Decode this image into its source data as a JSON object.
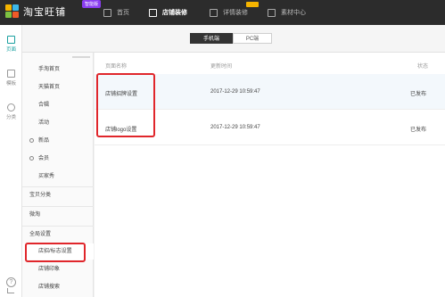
{
  "app": {
    "logo_text": "淘宝旺铺",
    "edition_badge": "智能版"
  },
  "nav": [
    {
      "label": "首页"
    },
    {
      "label": "店铺装修"
    },
    {
      "label": "详情装修"
    },
    {
      "label": "素材中心"
    }
  ],
  "rail": [
    {
      "label": "页面"
    },
    {
      "label": "模板"
    },
    {
      "label": "分类"
    }
  ],
  "device_tabs": {
    "mobile": "手机端",
    "pc": "PC端"
  },
  "menu": {
    "items": [
      {
        "label": "手淘首页"
      },
      {
        "label": "天猫首页"
      },
      {
        "label": "合辑"
      },
      {
        "label": "活动"
      },
      {
        "label": "新品"
      },
      {
        "label": "会员"
      },
      {
        "label": "买家秀"
      },
      {
        "label": "宝贝分类"
      },
      {
        "label": "微淘"
      },
      {
        "label": "全局设置"
      },
      {
        "label": "店招/标志设置"
      },
      {
        "label": "店铺印象"
      },
      {
        "label": "店铺搜索"
      }
    ]
  },
  "table": {
    "columns": [
      "页面名称",
      "更新时间",
      "状态"
    ],
    "rows": [
      {
        "name": "店铺招牌设置",
        "updated": "2017-12-29 10:59:47",
        "status": "已发布"
      },
      {
        "name": "店铺logo设置",
        "updated": "2017-12-29 10:59:47",
        "status": "已发布"
      }
    ]
  },
  "help_label": "?",
  "colors": {
    "topbar": "#2c2c2c",
    "accent_teal": "#1aa0a0",
    "badge_purple": "#8a3df0",
    "highlight_red": "#e0262b"
  }
}
